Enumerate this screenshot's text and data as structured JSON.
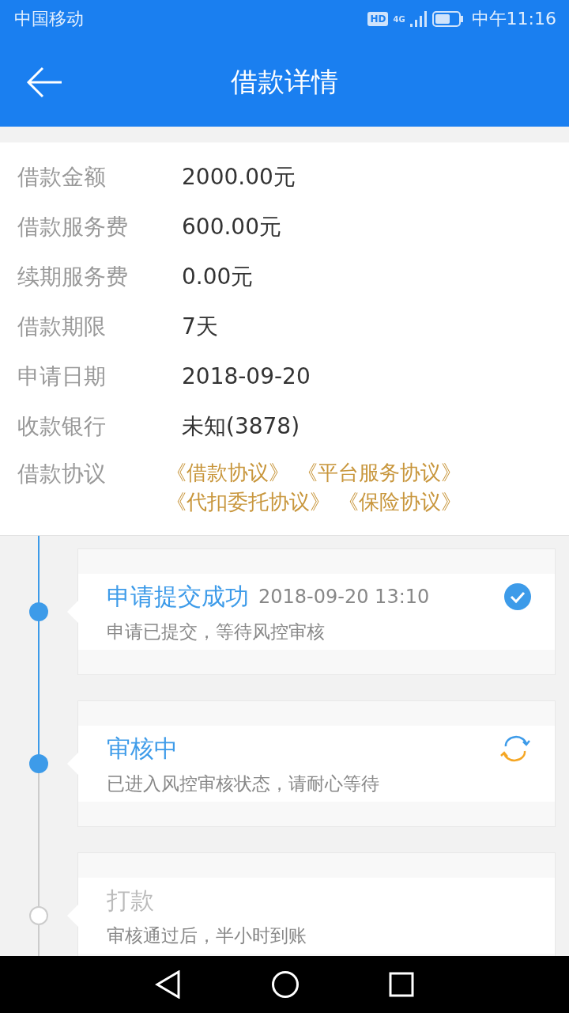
{
  "status_bar": {
    "carrier": "中国移动",
    "hd": "HD",
    "network": "4G",
    "time": "中午11:16"
  },
  "header": {
    "title": "借款详情"
  },
  "details": [
    {
      "label": "借款金额",
      "value": "2000.00元"
    },
    {
      "label": "借款服务费",
      "value": "600.00元"
    },
    {
      "label": "续期服务费",
      "value": "0.00元"
    },
    {
      "label": "借款期限",
      "value": "7天"
    },
    {
      "label": "申请日期",
      "value": "2018-09-20"
    },
    {
      "label": "收款银行",
      "value": "未知(3878)"
    }
  ],
  "agreements": {
    "label": "借款协议",
    "links": [
      "《借款协议》",
      "《平台服务协议》",
      "《代扣委托协议》",
      "《保险协议》"
    ]
  },
  "steps": [
    {
      "kind": "done",
      "title": "申请提交成功",
      "time": "2018-09-20 13:10",
      "description": "申请已提交，等待风控审核"
    },
    {
      "kind": "active",
      "title": "审核中",
      "description": "已进入风控审核状态，请耐心等待"
    },
    {
      "kind": "pending",
      "title": "打款",
      "description": "审核通过后，半小时到账"
    }
  ]
}
